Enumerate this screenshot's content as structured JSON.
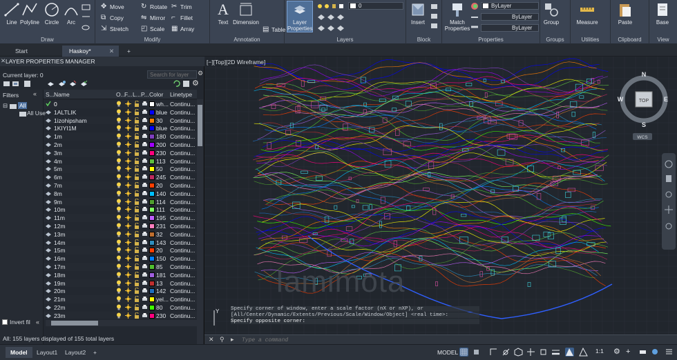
{
  "ribbon": {
    "draw": {
      "title": "Draw",
      "tools": [
        "Line",
        "Polyline",
        "Circle",
        "Arc"
      ]
    },
    "modify": {
      "title": "Modify",
      "tools": [
        "Move",
        "Rotate",
        "Trim",
        "Copy",
        "Mirror",
        "Fillet",
        "Stretch",
        "Scale",
        "Array"
      ]
    },
    "annotation": {
      "title": "Annotation",
      "tools": [
        "Text",
        "Dimension",
        "Table"
      ]
    },
    "layers": {
      "title": "Layers",
      "layer_properties_label": "Layer Properties",
      "layer_combo_value": "0"
    },
    "block": {
      "title": "Block",
      "insert_label": "Insert"
    },
    "properties": {
      "title": "Properties",
      "match_label": "Match Properties",
      "color_value": "ByLayer",
      "linetype_value": "ByLayer",
      "lineweight_value": "ByLayer"
    },
    "groups": {
      "title": "Groups",
      "group_label": "Group"
    },
    "utilities": {
      "title": "Utilities",
      "measure_label": "Measure"
    },
    "clipboard": {
      "title": "Clipboard",
      "paste_label": "Paste"
    },
    "view": {
      "title": "View",
      "base_label": "Base"
    }
  },
  "file_tabs": {
    "start": "Start",
    "current": "Haskoy*",
    "close": "✕",
    "new": "+"
  },
  "layer_manager": {
    "title": "LAYER PROPERTIES MANAGER",
    "close_glyph": "✕",
    "current_layer": "Current layer: 0",
    "search_placeholder": "Search for layer",
    "filters_label": "Filters",
    "collapse_glyph": "«",
    "tree_all": "All",
    "tree_all_used": "All Use",
    "invert_filter": "Invert fil",
    "status": "All: 155 layers displayed of 155 total layers",
    "columns": {
      "status": "S...",
      "name": "Name",
      "on": "O...",
      "freeze": "F...",
      "lock": "L...",
      "plot": "P...",
      "color": "Color",
      "linetype": "Linetype"
    },
    "rows": [
      {
        "name": "0",
        "color": "wh...",
        "hex": "#ffffff",
        "linetype": "Continu...",
        "current": true
      },
      {
        "name": "1ALTLIK",
        "color": "blue",
        "hex": "#0000ff",
        "linetype": "Continu..."
      },
      {
        "name": "1izohipsham",
        "color": "30",
        "hex": "#ff7f00",
        "linetype": "Continu..."
      },
      {
        "name": "1KIYI1M",
        "color": "blue",
        "hex": "#0000ff",
        "linetype": "Continu..."
      },
      {
        "name": "1m",
        "color": "180",
        "hex": "#7f3fbf",
        "linetype": "Continu..."
      },
      {
        "name": "2m",
        "color": "200",
        "hex": "#9f00ff",
        "linetype": "Continu..."
      },
      {
        "name": "3m",
        "color": "230",
        "hex": "#ff007f",
        "linetype": "Continu..."
      },
      {
        "name": "4m",
        "color": "113",
        "hex": "#5fbf3f",
        "linetype": "Continu..."
      },
      {
        "name": "5m",
        "color": "50",
        "hex": "#ffff00",
        "linetype": "Continu..."
      },
      {
        "name": "6m",
        "color": "245",
        "hex": "#bf2a5f",
        "linetype": "Continu..."
      },
      {
        "name": "7m",
        "color": "20",
        "hex": "#ff3f00",
        "linetype": "Continu..."
      },
      {
        "name": "8m",
        "color": "140",
        "hex": "#00bfff",
        "linetype": "Continu..."
      },
      {
        "name": "9m",
        "color": "114",
        "hex": "#4f9f2f",
        "linetype": "Continu..."
      },
      {
        "name": "10m",
        "color": "111",
        "hex": "#7fff5f",
        "linetype": "Continu..."
      },
      {
        "name": "11m",
        "color": "195",
        "hex": "#bf5fff",
        "linetype": "Continu..."
      },
      {
        "name": "12m",
        "color": "231",
        "hex": "#ff7fbf",
        "linetype": "Continu..."
      },
      {
        "name": "13m",
        "color": "32",
        "hex": "#bf6f2f",
        "linetype": "Continu..."
      },
      {
        "name": "14m",
        "color": "143",
        "hex": "#2f8fbf",
        "linetype": "Continu..."
      },
      {
        "name": "15m",
        "color": "20",
        "hex": "#ff3f00",
        "linetype": "Continu..."
      },
      {
        "name": "16m",
        "color": "150",
        "hex": "#007fff",
        "linetype": "Continu..."
      },
      {
        "name": "17m",
        "color": "85",
        "hex": "#4fbf2f",
        "linetype": "Continu..."
      },
      {
        "name": "18m",
        "color": "181",
        "hex": "#9f5fdf",
        "linetype": "Continu..."
      },
      {
        "name": "19m",
        "color": "13",
        "hex": "#bf2f2f",
        "linetype": "Continu..."
      },
      {
        "name": "20m",
        "color": "142",
        "hex": "#1f6fbf",
        "linetype": "Continu..."
      },
      {
        "name": "21m",
        "color": "yel...",
        "hex": "#ffff00",
        "linetype": "Continu..."
      },
      {
        "name": "22m",
        "color": "80",
        "hex": "#3fff00",
        "linetype": "Continu..."
      },
      {
        "name": "23m",
        "color": "230",
        "hex": "#ff007f",
        "linetype": "Continu..."
      }
    ]
  },
  "viewport": {
    "label": "[−][Top][2D Wireframe]",
    "viewcube": {
      "n": "N",
      "s": "S",
      "e": "E",
      "w": "W",
      "top": "TOP",
      "wcs": "WCS"
    },
    "watermark": "lamimota",
    "command_history": [
      "Specify corner of window, enter a scale factor (nX or nXP), or",
      "[All/Center/Dynamic/Extents/Previous/Scale/Window/Object] <real time>:",
      "Specify opposite corner:"
    ],
    "command_placeholder": "Type a command"
  },
  "statusbar": {
    "tabs": [
      "Model",
      "Layout1",
      "Layout2"
    ],
    "add": "+",
    "model_label": "MODEL",
    "scale": "1:1"
  },
  "colors": {
    "ribbon_bg": "#3b4453",
    "panel_bg": "#232830",
    "viewport_bg": "#21262d",
    "accent": "#4b6f9f"
  }
}
